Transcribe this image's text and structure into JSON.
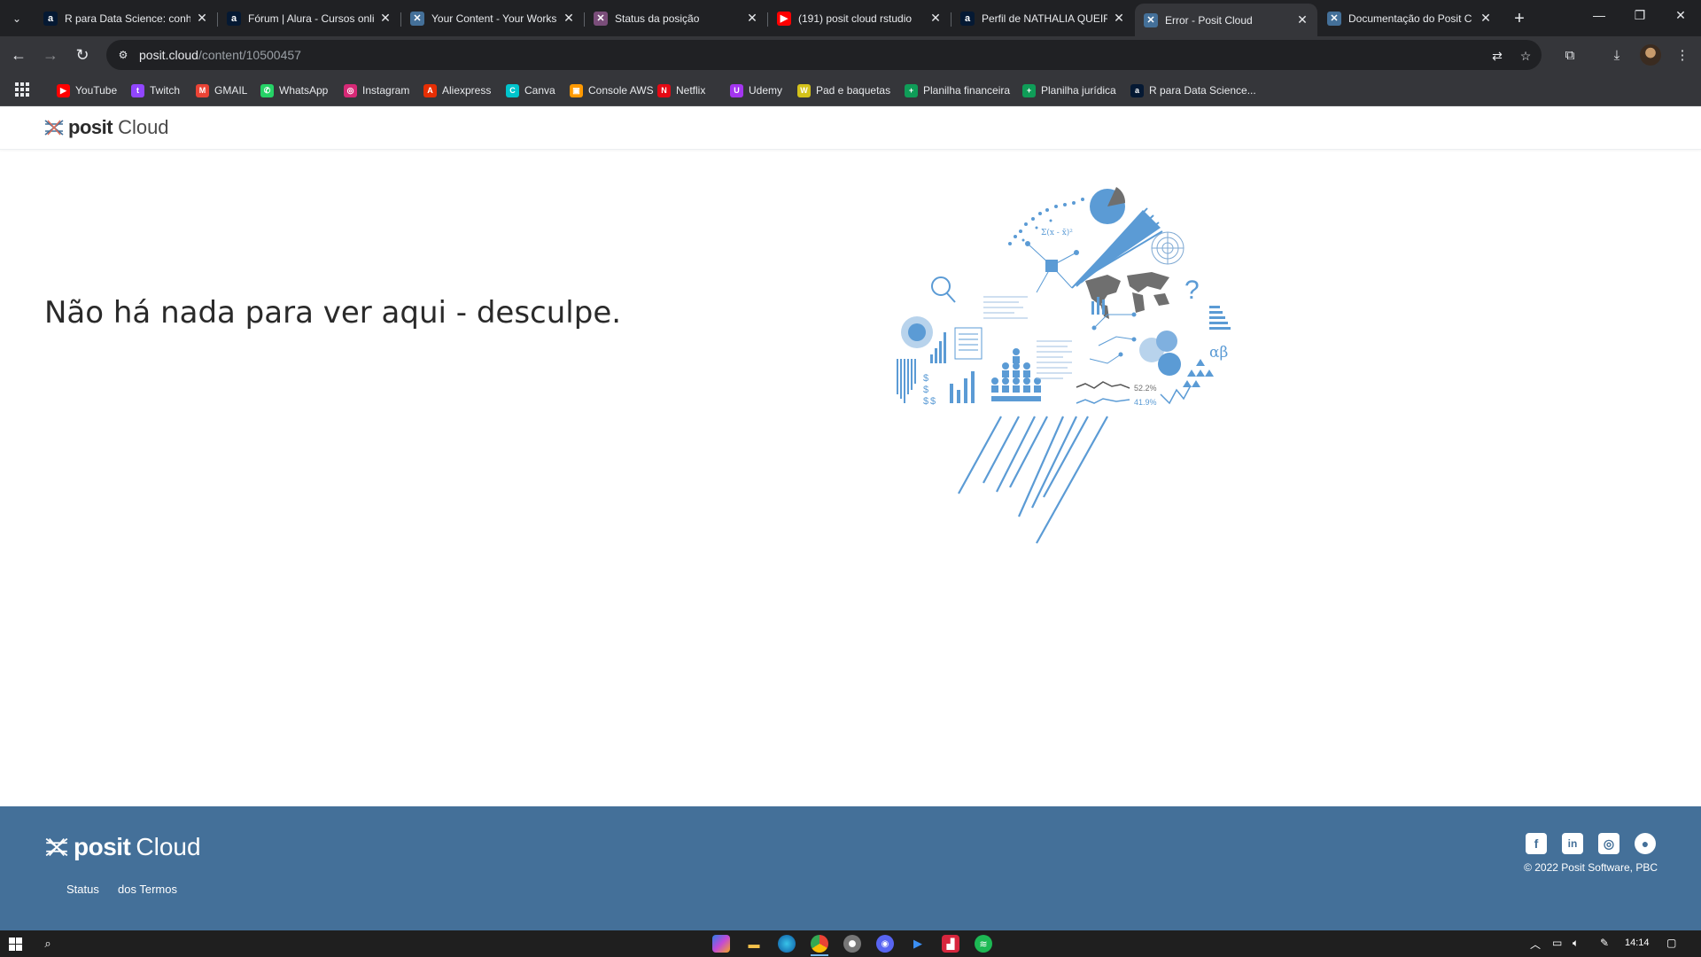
{
  "browser": {
    "tabs": [
      {
        "title": "R para Data Science: conhe",
        "icon": "alura-icon",
        "color": "#051933",
        "glyph": "a",
        "active": false
      },
      {
        "title": "Fórum | Alura - Cursos onli",
        "icon": "alura-icon",
        "color": "#051933",
        "glyph": "a",
        "active": false
      },
      {
        "title": "Your Content - Your Works",
        "icon": "posit-icon",
        "color": "#447099",
        "glyph": "✕",
        "active": false
      },
      {
        "title": "Status da posição",
        "icon": "posit-icon",
        "color": "#7a4d7a",
        "glyph": "✕",
        "active": false
      },
      {
        "title": "(191) posit cloud rstudio",
        "icon": "youtube-icon",
        "color": "#ff0000",
        "glyph": "▶",
        "active": false
      },
      {
        "title": "Perfil de NATHALIA QUEIR",
        "icon": "alura-icon",
        "color": "#051933",
        "glyph": "a",
        "active": false
      },
      {
        "title": "Error - Posit Cloud",
        "icon": "posit-icon",
        "color": "#447099",
        "glyph": "✕",
        "active": true
      },
      {
        "title": "Documentação do Posit C",
        "icon": "posit-icon",
        "color": "#447099",
        "glyph": "✕",
        "active": false
      }
    ],
    "url_host": "posit.cloud",
    "url_path": "/content/10500457",
    "bookmarks": [
      {
        "label": "YouTube",
        "icon": "youtube-icon",
        "color": "#ff0000",
        "glyph": "▶"
      },
      {
        "label": "Twitch",
        "icon": "twitch-icon",
        "color": "#9146ff",
        "glyph": "t"
      },
      {
        "label": "GMAIL",
        "icon": "gmail-icon",
        "color": "#ea4335",
        "glyph": "M"
      },
      {
        "label": "WhatsApp",
        "icon": "whatsapp-icon",
        "color": "#25d366",
        "glyph": "✆"
      },
      {
        "label": "Instagram",
        "icon": "instagram-icon",
        "color": "#d62976",
        "glyph": "◎"
      },
      {
        "label": "Aliexpress",
        "icon": "aliexpress-icon",
        "color": "#e62e04",
        "glyph": "A"
      },
      {
        "label": "Canva",
        "icon": "canva-icon",
        "color": "#00c4cc",
        "glyph": "C"
      },
      {
        "label": "Console AWS",
        "icon": "aws-icon",
        "color": "#ff9900",
        "glyph": "▣"
      },
      {
        "label": "Netflix",
        "icon": "netflix-icon",
        "color": "#e50914",
        "glyph": "N"
      },
      {
        "label": "Udemy",
        "icon": "udemy-icon",
        "color": "#a435f0",
        "glyph": "U"
      },
      {
        "label": "Pad e baquetas",
        "icon": "pad-icon",
        "color": "#d4c21a",
        "glyph": "W"
      },
      {
        "label": "Planilha financeira",
        "icon": "sheets-icon",
        "color": "#0f9d58",
        "glyph": "+"
      },
      {
        "label": "Planilha jurídica",
        "icon": "sheets-icon",
        "color": "#0f9d58",
        "glyph": "+"
      },
      {
        "label": "R para Data Science...",
        "icon": "alura-icon",
        "color": "#051933",
        "glyph": "a"
      }
    ]
  },
  "page": {
    "brand": "posit",
    "product": "Cloud",
    "error_message": "Não há nada para ver aqui - desculpe.",
    "illustration": {
      "labels": {
        "stat_a": "52.2%",
        "stat_b": "41.9%",
        "greek": "αβ",
        "question": "?",
        "dollar": "$",
        "fraction": "Σ(x - x̄)²"
      }
    }
  },
  "footer": {
    "brand": "posit",
    "product": "Cloud",
    "links": [
      "Status",
      "dos Termos"
    ],
    "copyright": "© 2022 Posit Software, PBC",
    "social": [
      {
        "name": "facebook-icon",
        "glyph": "f"
      },
      {
        "name": "linkedin-icon",
        "glyph": "in"
      },
      {
        "name": "instagram-icon",
        "glyph": "◎"
      },
      {
        "name": "github-icon",
        "glyph": "●"
      }
    ],
    "color": "#447099"
  },
  "taskbar": {
    "clock": "14:14"
  }
}
